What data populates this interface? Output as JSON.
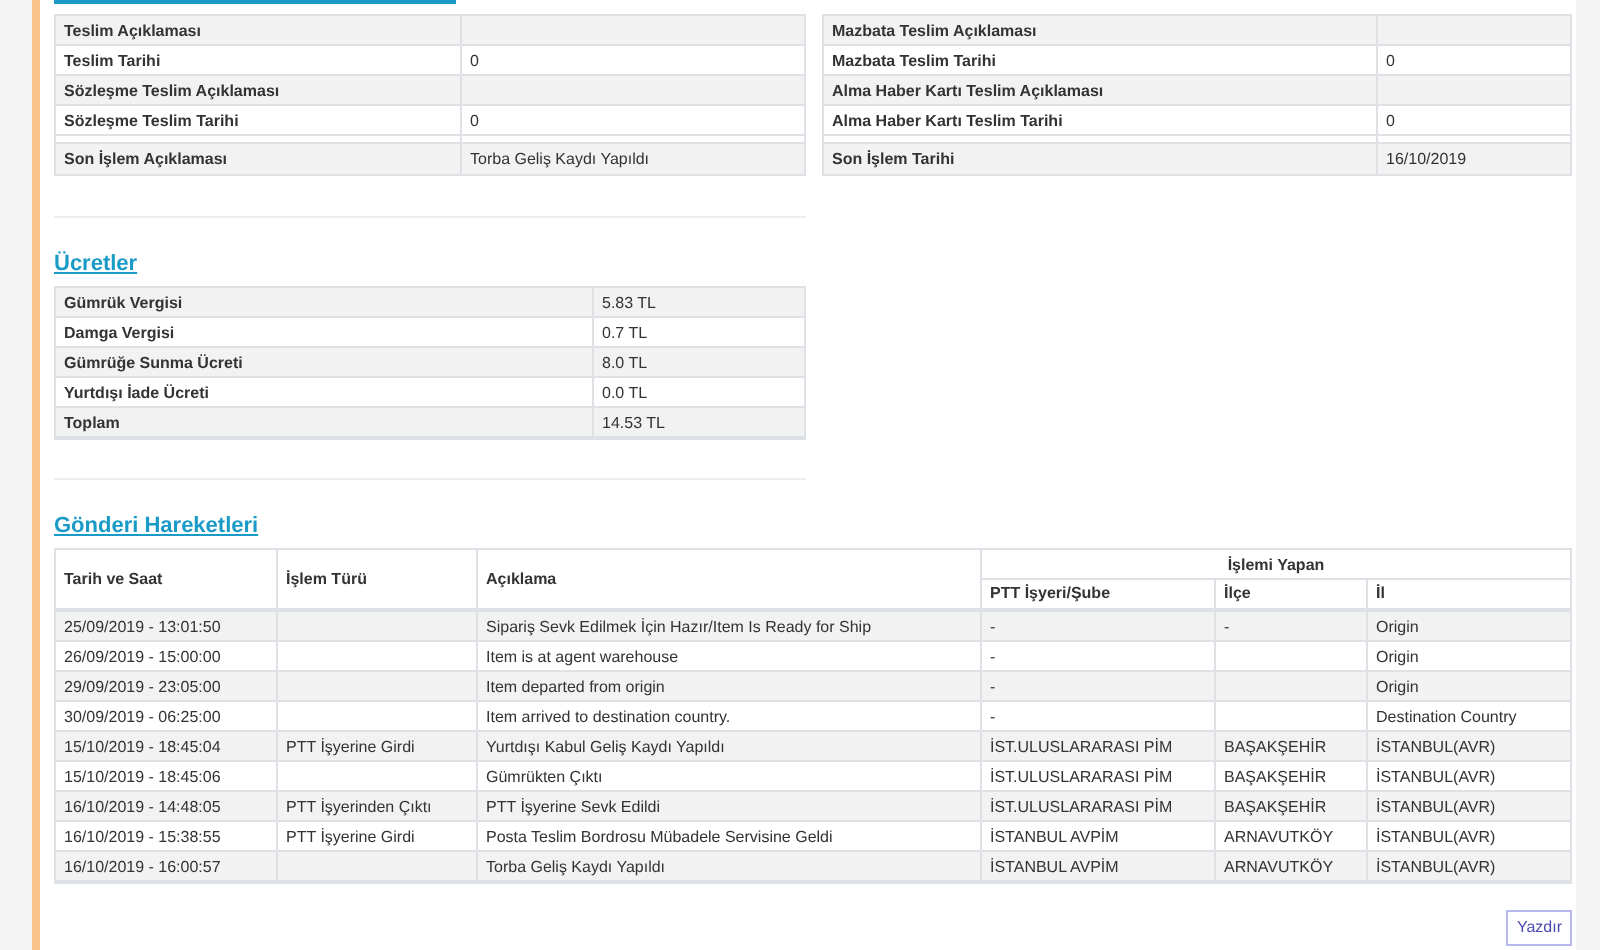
{
  "delivery": {
    "left": [
      {
        "label": "Teslim Açıklaması"
      },
      {
        "label": "Teslim Tarihi",
        "value": "0"
      },
      {
        "label": "Sözleşme Teslim Açıklaması"
      },
      {
        "label": "Sözleşme Teslim Tarihi",
        "value": "0"
      }
    ],
    "left_last": {
      "label": "Son İşlem Açıklaması",
      "value": "Torba Geliş Kaydı Yapıldı"
    },
    "right": [
      {
        "label": "Mazbata Teslim Açıklaması"
      },
      {
        "label": "Mazbata Teslim Tarihi",
        "value": "0"
      },
      {
        "label": "Alma Haber Kartı Teslim Açıklaması"
      },
      {
        "label": "Alma Haber Kartı Teslim Tarihi",
        "value": "0"
      }
    ],
    "right_last": {
      "label": "Son İşlem Tarihi",
      "value": "16/10/2019"
    }
  },
  "fees": {
    "title": "Ücretler",
    "rows": [
      {
        "label": "Gümrük Vergisi",
        "value": "5.83 TL"
      },
      {
        "label": "Damga Vergisi",
        "value": "0.7 TL"
      },
      {
        "label": "Gümrüğe Sunma Ücreti",
        "value": "8.0 TL"
      },
      {
        "label": "Yurtdışı İade Ücreti",
        "value": "0.0 TL"
      },
      {
        "label": "Toplam",
        "value": "14.53 TL"
      }
    ]
  },
  "movements": {
    "title": "Gönderi Hareketleri",
    "columns": [
      "Tarih ve Saat",
      "İşlem Türü",
      "Açıklama"
    ],
    "group_header": "İşlemi Yapan",
    "sub_columns": [
      "PTT İşyeri/Şube",
      "İlçe",
      "İl"
    ],
    "rows": [
      [
        "25/09/2019 - 13:01:50",
        null,
        "Sipariş Sevk Edilmek İçin Hazır/Item Is Ready for Ship",
        "-",
        "-",
        "Origin"
      ],
      [
        "26/09/2019 - 15:00:00",
        null,
        "Item is at agent warehouse",
        "-",
        null,
        "Origin"
      ],
      [
        "29/09/2019 - 23:05:00",
        null,
        "Item departed from origin",
        "-",
        null,
        "Origin"
      ],
      [
        "30/09/2019 - 06:25:00",
        null,
        "Item arrived to destination country.",
        "-",
        null,
        "Destination Country"
      ],
      [
        "15/10/2019 - 18:45:04",
        "PTT İşyerine Girdi",
        "Yurtdışı Kabul Geliş Kaydı Yapıldı",
        "İST.ULUSLARARASI PİM",
        "BAŞAKŞEHİR",
        "İSTANBUL(AVR)"
      ],
      [
        "15/10/2019 - 18:45:06",
        null,
        "Gümrükten Çıktı",
        "İST.ULUSLARARASI PİM",
        "BAŞAKŞEHİR",
        "İSTANBUL(AVR)"
      ],
      [
        "16/10/2019 - 14:48:05",
        "PTT İşyerinden Çıktı",
        "PTT İşyerine Sevk Edildi",
        "İST.ULUSLARARASI PİM",
        "BAŞAKŞEHİR",
        "İSTANBUL(AVR)"
      ],
      [
        "16/10/2019 - 15:38:55",
        "PTT İşyerine Girdi",
        "Posta Teslim Bordrosu Mübadele Servisine Geldi",
        "İSTANBUL AVPİM",
        "ARNAVUTKÖY",
        "İSTANBUL(AVR)"
      ],
      [
        "16/10/2019 - 16:00:57",
        null,
        "Torba Geliş Kaydı Yapıldı",
        "İSTANBUL AVPİM",
        "ARNAVUTKÖY",
        "İSTANBUL(AVR)"
      ]
    ]
  },
  "print_button": "Yazdır"
}
